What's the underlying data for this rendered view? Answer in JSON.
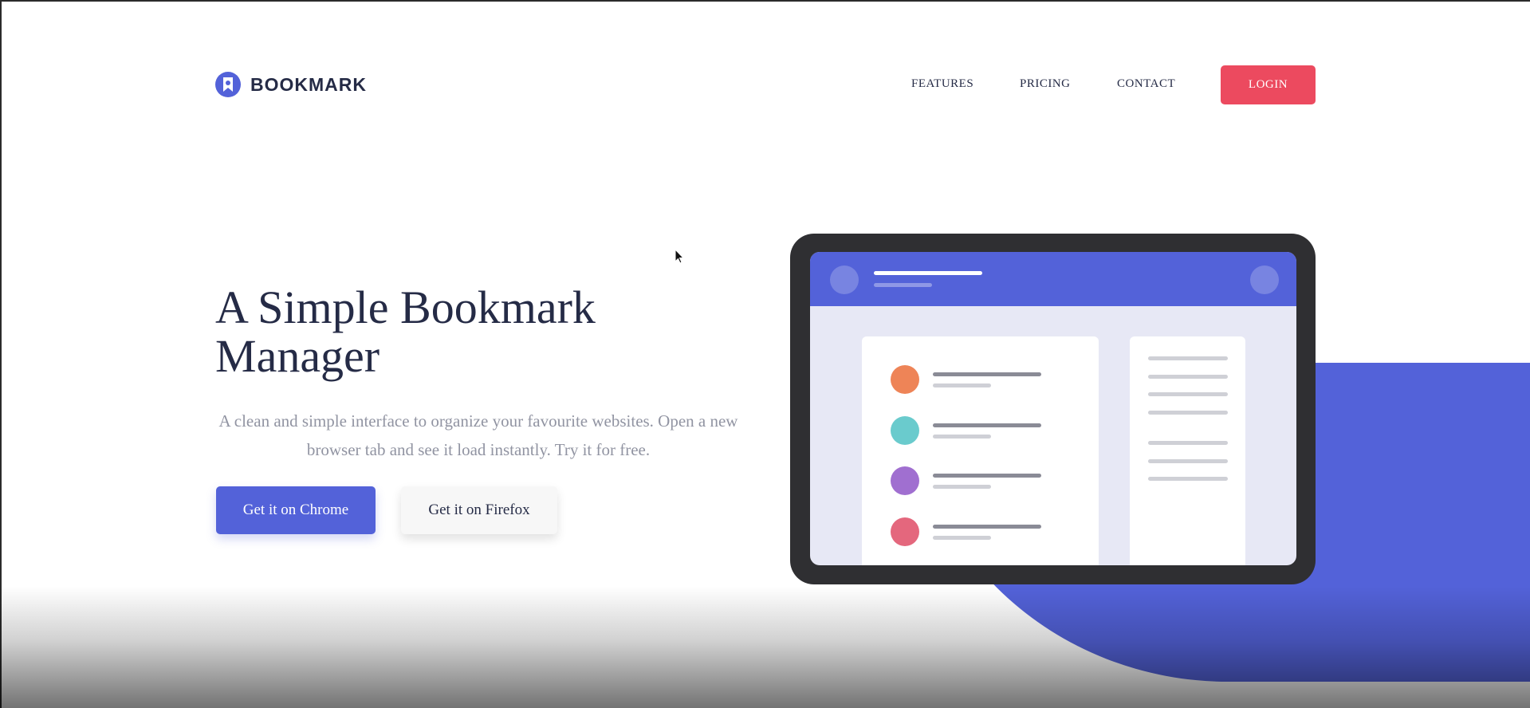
{
  "colors": {
    "accent": "#5362d9",
    "login": "#ec4a5f",
    "dot_orange": "#ee8457",
    "dot_teal": "#6acbcd",
    "dot_purple": "#a06fd0",
    "dot_red": "#e4677d"
  },
  "header": {
    "logo_icon": "bookmark-icon",
    "logo_text": "BOOKMARK",
    "nav": [
      "FEATURES",
      "PRICING",
      "CONTACT"
    ],
    "login_label": "LOGIN"
  },
  "hero": {
    "title_line1": "A Simple Bookmark",
    "title_line2": "Manager",
    "description": "A clean and simple interface to organize your favourite websites. Open a new browser tab and see it load instantly. Try it for free.",
    "chrome_button": "Get it on Chrome",
    "firefox_button": "Get it on Firefox"
  },
  "illustration": {
    "type": "tablet-mockup",
    "list_dot_colors": [
      "orange",
      "teal",
      "purple",
      "red"
    ]
  },
  "cursor": "arrow-cursor-icon"
}
